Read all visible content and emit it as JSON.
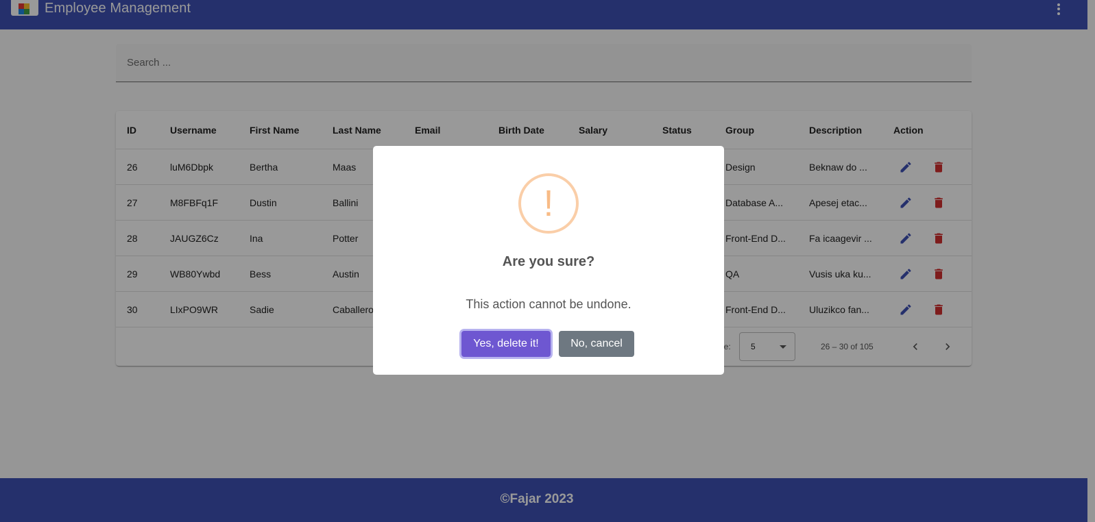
{
  "app": {
    "title": "Employee Management"
  },
  "colors": {
    "primary": "#3f51b5",
    "edit_icon": "#3f51b5",
    "delete_icon": "#d32f2f",
    "confirm": "#6e57d1",
    "cancel": "#6e7881",
    "warning": "#f8bb86"
  },
  "search": {
    "placeholder": "Search ..."
  },
  "table": {
    "headers": [
      "ID",
      "Username",
      "First Name",
      "Last Name",
      "Email",
      "Birth Date",
      "Salary",
      "Status",
      "Group",
      "Description",
      "Action"
    ],
    "rows": [
      {
        "id": "26",
        "username": "luM6Dbpk",
        "first": "Bertha",
        "last": "Maas",
        "group": "Design",
        "description": "Beknaw do ..."
      },
      {
        "id": "27",
        "username": "M8FBFq1F",
        "first": "Dustin",
        "last": "Ballini",
        "group": "Database A...",
        "description": "Apesej etac..."
      },
      {
        "id": "28",
        "username": "JAUGZ6Cz",
        "first": "Ina",
        "last": "Potter",
        "group": "Front-End D...",
        "description": "Fa icaagevir ..."
      },
      {
        "id": "29",
        "username": "WB80Ywbd",
        "first": "Bess",
        "last": "Austin",
        "group": "QA",
        "description": "Vusis uka ku..."
      },
      {
        "id": "30",
        "username": "LIxPO9WR",
        "first": "Sadie",
        "last": "Caballero",
        "group": "Front-End D...",
        "description": "Uluzikco fan..."
      }
    ]
  },
  "paginator": {
    "label_fragment": "ge:",
    "page_size": "5",
    "range": "26 – 30 of 105"
  },
  "footer": {
    "text": "©Fajar 2023"
  },
  "dialog": {
    "icon": "warning-icon",
    "icon_glyph": "!",
    "title": "Are you sure?",
    "text": "This action cannot be undone.",
    "confirm_label": "Yes, delete it!",
    "cancel_label": "No, cancel"
  }
}
